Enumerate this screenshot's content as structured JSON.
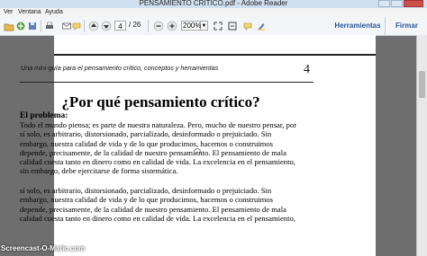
{
  "window": {
    "title": "PENSAMIENTO CRÍTICO.pdf - Adobe Reader"
  },
  "menu": [
    "Ver",
    "Ventana",
    "Ayuda"
  ],
  "toolbar": {
    "page_current": "4",
    "page_total": "/ 26",
    "zoom": "200%",
    "tools_label": "Herramientas",
    "sign_label": "Firmar"
  },
  "doc": {
    "header_text": "Una mini-guía para el pensamiento crítico, conceptos y herramientas",
    "page_number": "4",
    "heading": "¿Por qué pensamiento crítico?",
    "subheading": "El problema:",
    "para1": [
      "Todo el mundo piensa; es parte de nuestra naturaleza. Pero, mucho de nuestro pensar, por",
      "sí solo, es arbitrario, distorsionado, parcializado, desinformado o prejuiciado. Sin",
      "embargo, nuestra calidad de vida y de lo que producimos, hacemos o construimos",
      "depende, precisamente, de la calidad de nuestro pensamiento. El pensamiento de mala",
      "calidad cuesta tanto en dinero como en calidad de vida. La excelencia en el pensamiento,",
      "sin embargo, debe ejercitarse de forma sistemática."
    ],
    "para2": [
      "sí solo, es arbitrario, distorsionado, parcializado, desinformado o prejuiciado. Sin",
      "embargo, nuestra calidad de vida y de lo que producimos, hacemos o construimos",
      "depende, precisamente, de la calidad de nuestro pensamiento. El pensamiento de mala",
      "calidad cuesta tanto en dinero como en calidad de vida. La excelencia en el pensamiento,"
    ]
  },
  "watermark": "Screencast-O-Matic.com",
  "icons": [
    "open-icon",
    "print-icon",
    "email-icon",
    "prev-page-icon",
    "next-page-icon",
    "zoom-out-icon",
    "zoom-in-icon",
    "fit-page-icon",
    "fullscreen-icon",
    "comment-icon"
  ]
}
